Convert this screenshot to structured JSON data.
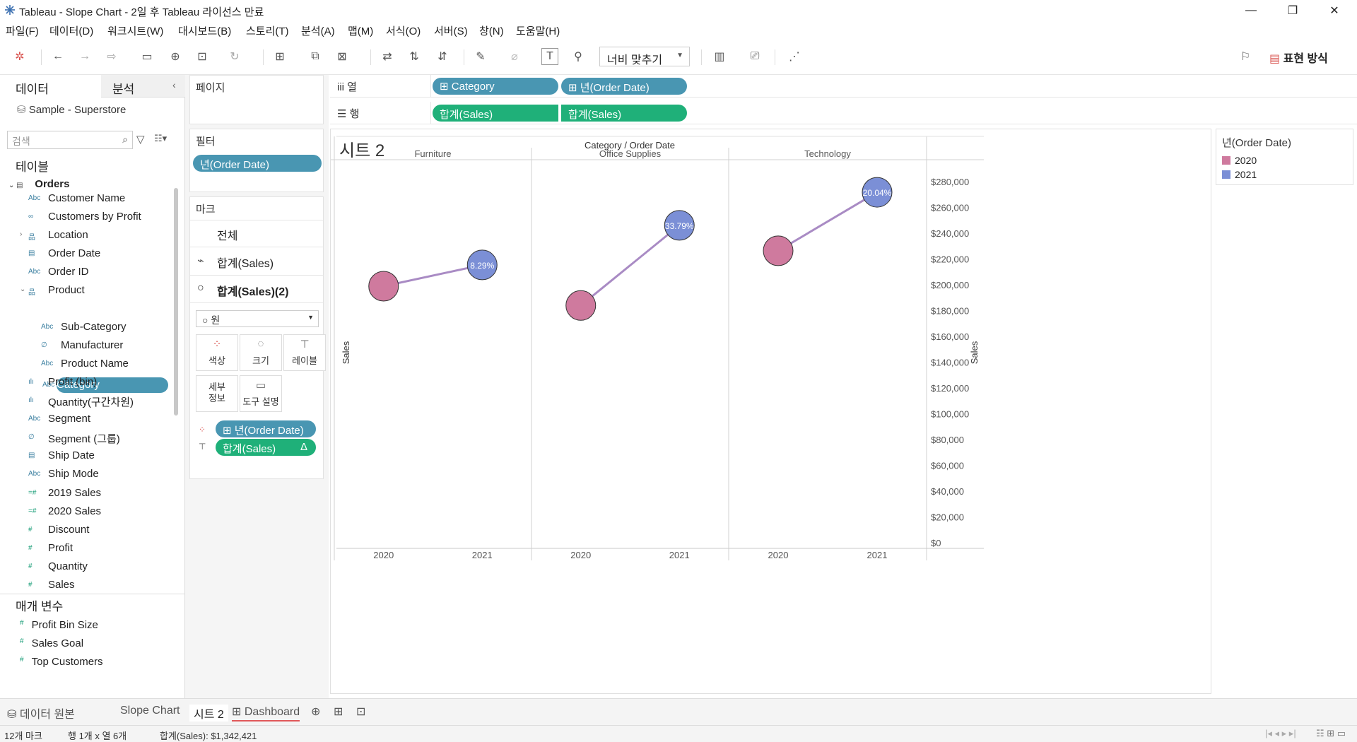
{
  "window": {
    "title": "Tableau - Slope Chart - 2일 후 Tableau 라이선스 만료"
  },
  "menu": [
    "파일(F)",
    "데이터(D)",
    "워크시트(W)",
    "대시보드(B)",
    "스토리(T)",
    "분석(A)",
    "맵(M)",
    "서식(O)",
    "서버(S)",
    "창(N)",
    "도움말(H)"
  ],
  "toolbar": {
    "fit_label": "너비 맞추기",
    "show_me_label": "표현 방식"
  },
  "datapane": {
    "tab_data": "데이터",
    "tab_analysis": "분석",
    "datasource": "Sample - Superstore",
    "search_placeholder": "검색",
    "tables_heading": "테이블",
    "table_name": "Orders",
    "fields": [
      {
        "name": "Customer Name",
        "icon": "Abc"
      },
      {
        "name": "Customers by Profit",
        "icon": "∞"
      },
      {
        "name": "Location",
        "icon": "品"
      },
      {
        "name": "Order Date",
        "icon": "▤"
      },
      {
        "name": "Order ID",
        "icon": "Abc"
      },
      {
        "name": "Product",
        "icon": "品"
      },
      {
        "name": "Category",
        "icon": "Abc"
      },
      {
        "name": "Sub-Category",
        "icon": "Abc"
      },
      {
        "name": "Manufacturer",
        "icon": "∅"
      },
      {
        "name": "Product Name",
        "icon": "Abc"
      },
      {
        "name": "Profit (bin)",
        "icon": "ılı"
      },
      {
        "name": "Quantity(구간차원)",
        "icon": "ılı"
      },
      {
        "name": "Segment",
        "icon": "Abc"
      },
      {
        "name": "Segment (그룹)",
        "icon": "∅"
      },
      {
        "name": "Ship Date",
        "icon": "▤"
      },
      {
        "name": "Ship Mode",
        "icon": "Abc"
      },
      {
        "name": "2019 Sales",
        "icon": "=#"
      },
      {
        "name": "2020 Sales",
        "icon": "=#"
      },
      {
        "name": "Discount",
        "icon": "#"
      },
      {
        "name": "Profit",
        "icon": "#"
      },
      {
        "name": "Quantity",
        "icon": "#"
      },
      {
        "name": "Sales",
        "icon": "#"
      }
    ],
    "params_heading": "매개 변수",
    "params": [
      "Profit Bin Size",
      "Sales Goal",
      "Top Customers"
    ]
  },
  "shelves": {
    "pages_label": "페이지",
    "filters_label": "필터",
    "filter_pill": "년(Order Date)",
    "marks_label": "마크",
    "marks_all": "전체",
    "marks_sum_sales": "합계(Sales)",
    "marks_sum_sales2": "합계(Sales)(2)",
    "mark_type": "원",
    "btn_color": "색상",
    "btn_size": "크기",
    "btn_label": "레이블",
    "btn_detail": "세부 정보",
    "btn_tooltip": "도구 설명",
    "mark_pill_color": "년(Order Date)",
    "mark_pill_label": "합계(Sales)",
    "mark_pill_label_delta": "Δ"
  },
  "columns": {
    "label": "열",
    "pills": [
      "Category",
      "년(Order Date)"
    ]
  },
  "rows": {
    "label": "행",
    "pills": [
      "합계(Sales)",
      "합계(Sales)"
    ]
  },
  "sheet": {
    "title": "시트 2"
  },
  "legend": {
    "title": "년(Order Date)",
    "items": [
      {
        "label": "2020",
        "color": "#cf7a9e"
      },
      {
        "label": "2021",
        "color": "#7b8fd6"
      }
    ]
  },
  "chart_data": {
    "type": "line",
    "header_title": "Category  /  Order Date",
    "panes": [
      {
        "category": "Furniture",
        "points": [
          {
            "x": "2020",
            "y": 198901
          },
          {
            "x": "2021",
            "y": 215387
          }
        ],
        "label": "8.29%"
      },
      {
        "category": "Office Supplies",
        "points": [
          {
            "x": "2020",
            "y": 183939
          },
          {
            "x": "2021",
            "y": 246097
          }
        ],
        "label": "33.79%"
      },
      {
        "category": "Technology",
        "points": [
          {
            "x": "2020",
            "y": 226364
          },
          {
            "x": "2021",
            "y": 271731
          }
        ],
        "label": "20.04%"
      }
    ],
    "ylabel": "Sales",
    "ylim": [
      0,
      290000
    ],
    "yticks": [
      0,
      20000,
      40000,
      60000,
      80000,
      100000,
      120000,
      140000,
      160000,
      180000,
      200000,
      220000,
      240000,
      260000,
      280000
    ],
    "ytick_labels": [
      "$0",
      "$20,000",
      "$40,000",
      "$60,000",
      "$80,000",
      "$100,000",
      "$120,000",
      "$140,000",
      "$160,000",
      "$180,000",
      "$200,000",
      "$220,000",
      "$240,000",
      "$260,000",
      "$280,000"
    ],
    "line_color": "#a98bc4",
    "colors": {
      "2020": "#cf7a9e",
      "2021": "#7b8fd6"
    }
  },
  "tabs": {
    "datasource": "데이터 원본",
    "sheets": [
      "Slope Chart",
      "시트 2",
      "Dashboard"
    ]
  },
  "status": {
    "marks": "12개 마크",
    "dims": "행 1개 x 열 6개",
    "sum": "합계(Sales): $1,342,421"
  }
}
